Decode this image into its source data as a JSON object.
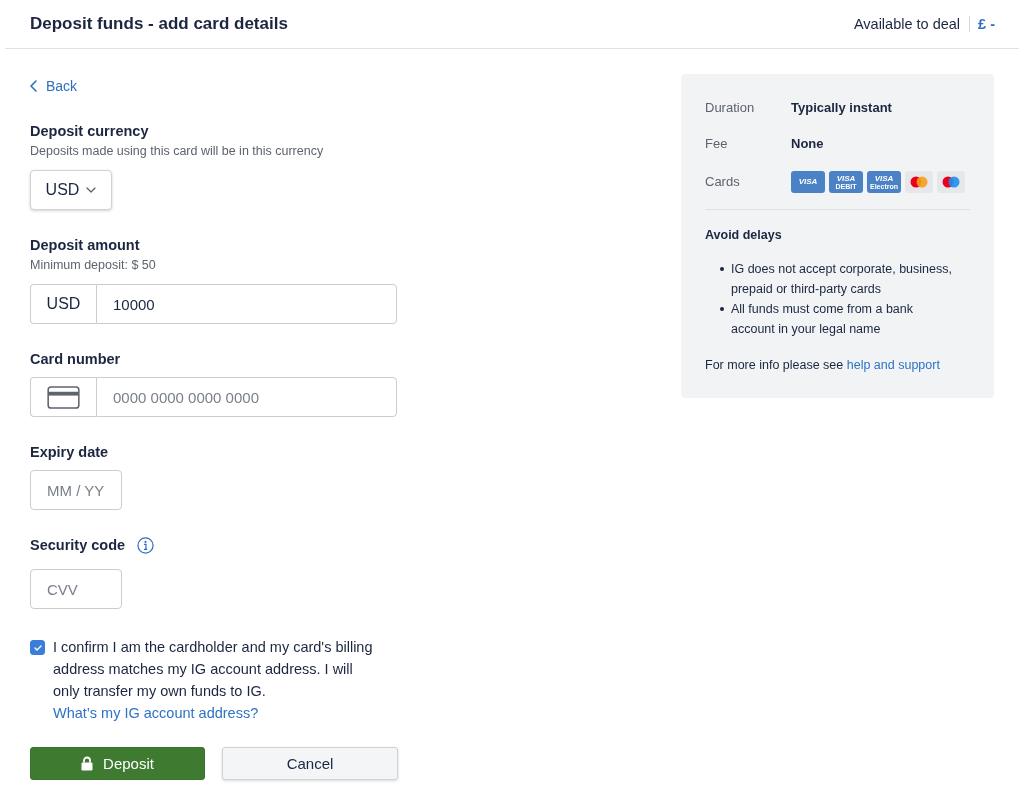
{
  "header": {
    "title": "Deposit funds - add card details",
    "available_label": "Available to deal",
    "available_value": "£ -"
  },
  "back_link": {
    "label": "Back"
  },
  "form": {
    "currency": {
      "label": "Deposit currency",
      "hint": "Deposits made using this card will be in this currency",
      "value": "USD"
    },
    "amount": {
      "label": "Deposit amount",
      "hint": "Minimum deposit: $ 50",
      "prefix": "USD",
      "value": "10000"
    },
    "card_number": {
      "label": "Card number",
      "placeholder": "0000 0000 0000 0000"
    },
    "expiry": {
      "label": "Expiry date",
      "placeholder": "MM / YY"
    },
    "security_code": {
      "label": "Security code",
      "placeholder": "CVV"
    },
    "confirm": {
      "checked": true,
      "text": "I confirm I am the cardholder and my card's billing address matches my IG account address. I will only transfer my own funds to IG.",
      "link": "What’s my IG account address?"
    }
  },
  "buttons": [
    {
      "kind": "primary",
      "label": "Deposit"
    },
    {
      "kind": "secondary",
      "label": "Cancel"
    }
  ],
  "info_panel": {
    "rows": [
      {
        "label": "Duration",
        "value": "Typically instant"
      },
      {
        "label": "Fee",
        "value": "None"
      }
    ],
    "cards_label": "Cards",
    "cards": [
      {
        "kind": "visa",
        "label": "VISA"
      },
      {
        "kind": "visa",
        "label": "VISA",
        "sublabel": "DEBIT"
      },
      {
        "kind": "visa",
        "label": "VISA",
        "sublabel": "Electron"
      },
      {
        "kind": "mastercard"
      },
      {
        "kind": "maestro"
      }
    ],
    "notice_title": "Avoid delays",
    "bullets": [
      "IG does not accept corporate, business, prepaid or third-party cards",
      "All funds must come from a bank account in your legal name"
    ],
    "more_info": {
      "text": "For more info please see",
      "link": "help and support"
    }
  }
}
